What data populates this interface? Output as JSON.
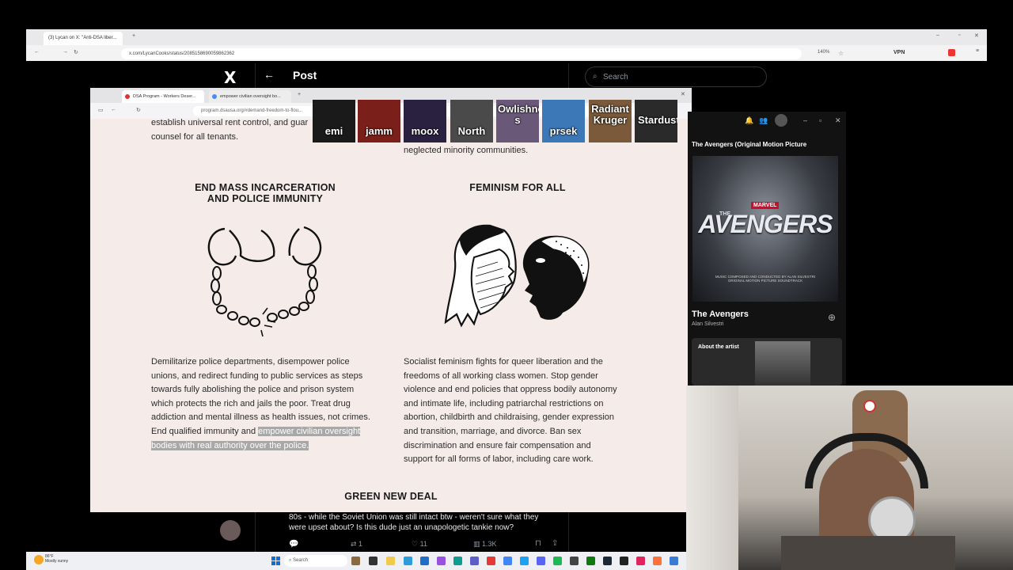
{
  "back_browser": {
    "tab_title": "(3) Lycan on X: \"Anti-DSA liber...",
    "url": "x.com/LycanCooks/status/2085158690059862362",
    "zoom": "140%",
    "vpn": "VPN"
  },
  "x": {
    "logo": "X",
    "back_arrow": "←",
    "post_title": "Post",
    "search_placeholder": "Search",
    "reply_text_1": "80s - while the Soviet Union was still intact btw - weren't sure what they",
    "reply_text_2": "were upset about? Is this dude just an unapologetic tankie now?",
    "actions": {
      "retweets": "1",
      "likes": "11",
      "views": "1.3K"
    }
  },
  "front_browser": {
    "tab1": "DSA Program - Workers Deser...",
    "tab2": "empower civilian oversight bo...",
    "url": "program.dsausa.org/#demand-freedom-to-flou...",
    "domain": "dsausa.org"
  },
  "page": {
    "top_left_1": "establish universal rent control, and guar",
    "top_left_2": "counsel for all tenants.",
    "top_right": "neglected minority communities.",
    "section1": {
      "heading_1": "END MASS INCARCERATION",
      "heading_2": "AND POLICE IMMUNITY",
      "lines": [
        "Demilitarize police departments, disempower police",
        "unions, and redirect funding to public services as steps",
        "towards fully abolishing the police and prison system",
        "which protects the rich and jails the poor. Treat drug",
        "addiction and mental illness as health issues, not crimes."
      ],
      "line6_plain": "End qualified immunity and ",
      "line6_hl": "empower civilian oversight",
      "line7_hl": "bodies with real authority over the police."
    },
    "section2": {
      "heading": "FEMINISM FOR ALL",
      "lines": [
        "Socialist feminism fights for queer liberation and the",
        "freedoms of all working class women. Stop gender",
        "violence and end policies that oppress bodily autonomy",
        "and intimate life, including patriarchal restrictions on",
        "abortion, childbirth and childraising, gender expression",
        "and transition, marriage, and divorce. Ban sex",
        "discrimination and ensure fair compensation and",
        "support for all forms of labor, including care work."
      ]
    },
    "section3": {
      "heading": "GREEN NEW DEAL"
    }
  },
  "avatars": [
    {
      "name": "emi",
      "color": "#1a1a1a"
    },
    {
      "name": "jamm",
      "color": "#7a1f1a"
    },
    {
      "name": "moox",
      "color": "#2a2140"
    },
    {
      "name": "North",
      "color": "#4a4a4a"
    },
    {
      "name": "Owlishnes s",
      "color": "#6a5878"
    },
    {
      "name": "prsek",
      "color": "#3c78b8"
    },
    {
      "name": "Radiant Kruger",
      "color": "#7a5a3a"
    },
    {
      "name": "Stardust",
      "color": "#2a2a2a"
    }
  ],
  "spotify": {
    "header": "The Avengers (Original Motion Picture",
    "cover_marvel": "MARVEL",
    "cover_title": "AVENGERS",
    "cover_prefix": "THE",
    "cover_credit_1": "MUSIC COMPOSED AND CONDUCTED BY ALAN SILVESTRI",
    "cover_credit_2": "ORIGINAL MOTION PICTURE SOUNDTRACK",
    "track": "The Avengers",
    "artist": "Alan Silvestri",
    "about": "About the artist"
  },
  "taskbar": {
    "weather_temp": "86°F",
    "weather_desc": "Mostly sunny",
    "search": "Search"
  }
}
